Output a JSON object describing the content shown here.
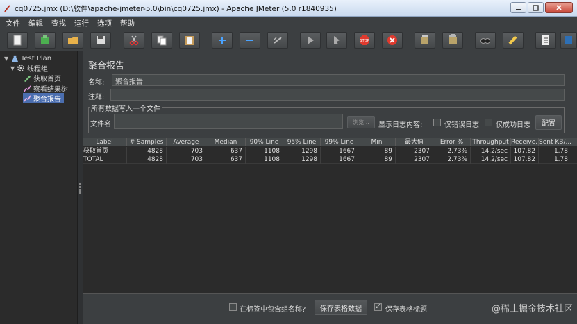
{
  "window": {
    "title": "cq0725.jmx (D:\\软件\\apache-jmeter-5.0\\bin\\cq0725.jmx) - Apache JMeter (5.0 r1840935)"
  },
  "menu": [
    "文件",
    "编辑",
    "查找",
    "运行",
    "选项",
    "帮助"
  ],
  "toolbar_icons": [
    "new-icon",
    "template-icon",
    "open-icon",
    "save-icon",
    "cut-icon",
    "copy-icon",
    "paste-icon",
    "expand-icon",
    "collapse-icon",
    "toggle-icon",
    "start-icon",
    "start-no-pause-icon",
    "stop-icon",
    "shutdown-icon",
    "clear-icon",
    "clear-all-icon",
    "search-icon",
    "reset-search-icon",
    "function-helper-icon",
    "help-icon"
  ],
  "tree": {
    "items": [
      {
        "label": "Test Plan",
        "level": 0,
        "icon": "flask-icon"
      },
      {
        "label": "线程组",
        "level": 1,
        "icon": "gear-icon"
      },
      {
        "label": "获取首页",
        "level": 2,
        "icon": "pen-icon"
      },
      {
        "label": "察看结果树",
        "level": 2,
        "icon": "graph-icon"
      },
      {
        "label": "聚合报告",
        "level": 2,
        "icon": "graph-icon",
        "selected": true
      }
    ]
  },
  "panel": {
    "title": "聚合报告",
    "name_label": "名称:",
    "name_value": "聚合报告",
    "comment_label": "注释:",
    "comment_value": "",
    "file_group_label": "所有数据写入一个文件",
    "filename_label": "文件名",
    "browse_label": "浏览...",
    "log_display_label": "显示日志内容:",
    "errors_only_label": "仅错误日志",
    "success_only_label": "仅成功日志",
    "configure_label": "配置"
  },
  "table": {
    "headers": [
      "Label",
      "# Samples",
      "Average",
      "Median",
      "90% Line",
      "95% Line",
      "99% Line",
      "Min",
      "最大值",
      "Error %",
      "Throughput",
      "Receive...",
      "Sent KB/..."
    ],
    "rows": [
      [
        "获取首页",
        "4828",
        "703",
        "637",
        "1108",
        "1298",
        "1667",
        "89",
        "2307",
        "2.73%",
        "14.2/sec",
        "107.82",
        "1.78"
      ],
      [
        "TOTAL",
        "4828",
        "703",
        "637",
        "1108",
        "1298",
        "1667",
        "89",
        "2307",
        "2.73%",
        "14.2/sec",
        "107.82",
        "1.78"
      ]
    ]
  },
  "bottom": {
    "include_group_label": "在标签中包含组名称?",
    "save_data_label": "保存表格数据",
    "save_header_label": "保存表格标题",
    "save_header_checked": true,
    "include_group_checked": false
  },
  "watermark": "@稀土掘金技术社区"
}
